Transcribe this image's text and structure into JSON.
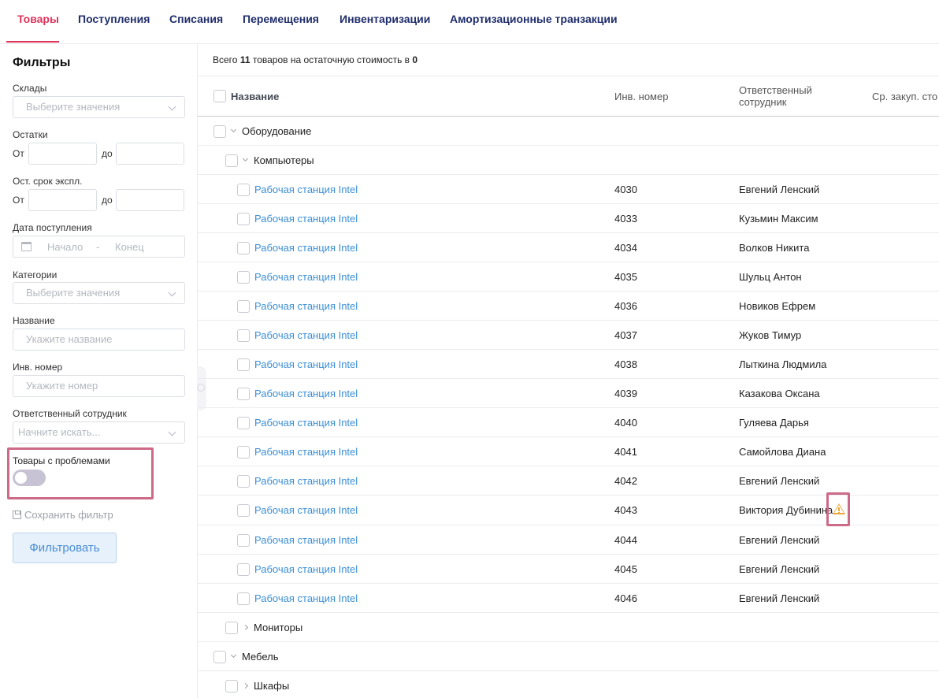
{
  "tabs": [
    "Товары",
    "Поступления",
    "Списания",
    "Перемещения",
    "Инвентаризации",
    "Амортизационные транзакции"
  ],
  "filters": {
    "title": "Фильтры",
    "warehouses_label": "Склады",
    "warehouses_placeholder": "Выберите значения",
    "remains_label": "Остатки",
    "from": "От",
    "to": "до",
    "remaining_life_label": "Ост. срок экспл.",
    "receipt_date_label": "Дата поступления",
    "date_start": "Начало",
    "date_sep": "-",
    "date_end": "Конец",
    "categories_label": "Категории",
    "categories_placeholder": "Выберите значения",
    "name_label": "Название",
    "name_placeholder": "Укажите название",
    "inv_label": "Инв. номер",
    "inv_placeholder": "Укажите номер",
    "employee_label": "Ответственный сотрудник",
    "employee_placeholder": "Начните искать...",
    "problems_label": "Товары с проблемами",
    "save_filter": "Сохранить фильтр",
    "filter_button": "Фильтровать"
  },
  "summary": {
    "prefix": "Всего ",
    "count": "11",
    "middle": " товаров на остаточную стоимость в ",
    "value": "0"
  },
  "table": {
    "col_name": "Название",
    "col_inv": "Инв. номер",
    "col_resp_1": "Ответственный",
    "col_resp_2": "сотрудник",
    "col_cost": "Ср. закуп. сто",
    "group_equipment": "Оборудование",
    "group_computers": "Компьютеры",
    "group_monitors": "Мониторы",
    "group_furniture": "Мебель",
    "group_cabinets": "Шкафы",
    "items": [
      {
        "name": "Рабочая станция Intel",
        "inv": "4030",
        "resp": "Евгений Ленский"
      },
      {
        "name": "Рабочая станция Intel",
        "inv": "4033",
        "resp": "Кузьмин Максим"
      },
      {
        "name": "Рабочая станция Intel",
        "inv": "4034",
        "resp": "Волков Никита"
      },
      {
        "name": "Рабочая станция Intel",
        "inv": "4035",
        "resp": "Шульц Антон"
      },
      {
        "name": "Рабочая станция Intel",
        "inv": "4036",
        "resp": "Новиков Ефрем"
      },
      {
        "name": "Рабочая станция Intel",
        "inv": "4037",
        "resp": "Жуков Тимур"
      },
      {
        "name": "Рабочая станция Intel",
        "inv": "4038",
        "resp": "Лыткина Людмила"
      },
      {
        "name": "Рабочая станция Intel",
        "inv": "4039",
        "resp": "Казакова Оксана"
      },
      {
        "name": "Рабочая станция Intel",
        "inv": "4040",
        "resp": "Гуляева Дарья"
      },
      {
        "name": "Рабочая станция Intel",
        "inv": "4041",
        "resp": "Самойлова Диана"
      },
      {
        "name": "Рабочая станция Intel",
        "inv": "4042",
        "resp": "Евгений Ленский"
      },
      {
        "name": "Рабочая станция Intel",
        "inv": "4043",
        "resp": "Виктория Дубинина"
      },
      {
        "name": "Рабочая станция Intel",
        "inv": "4044",
        "resp": "Евгений Ленский"
      },
      {
        "name": "Рабочая станция Intel",
        "inv": "4045",
        "resp": "Евгений Ленский"
      },
      {
        "name": "Рабочая станция Intel",
        "inv": "4046",
        "resp": "Евгений Ленский"
      }
    ]
  },
  "colors": {
    "accent": "#e0335c",
    "nav": "#1f2d6b",
    "link": "#3d8fd6",
    "highlight": "#cc6a87",
    "warning": "#f0a43a"
  },
  "icons": {
    "problem": "warning-icon",
    "calendar": "calendar-icon",
    "save": "floppy-icon"
  }
}
